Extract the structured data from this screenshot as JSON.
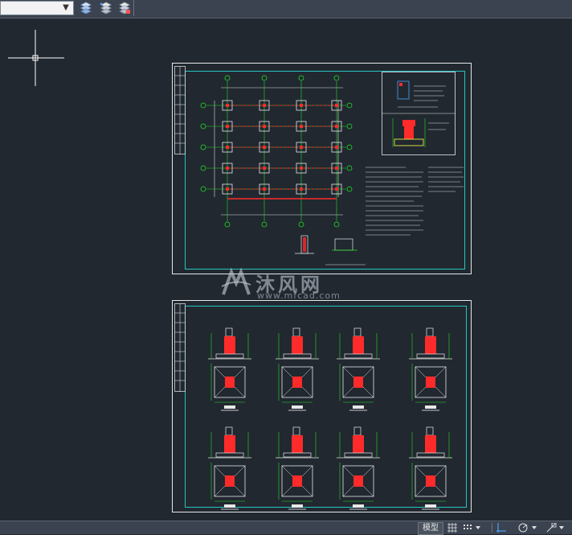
{
  "toolbar": {
    "layer_value": "",
    "icons": [
      "layer-match-icon",
      "layer-previous-icon",
      "layer-isolate-icon"
    ]
  },
  "statusbar": {
    "model_tab": "模型"
  },
  "watermark": {
    "brand": "沐风网",
    "url": "www.mfcad.com"
  },
  "colors": {
    "background": "#212830",
    "frame": "#27c4c0",
    "grid_line": "#ff2a2a",
    "green": "#22dd22"
  }
}
